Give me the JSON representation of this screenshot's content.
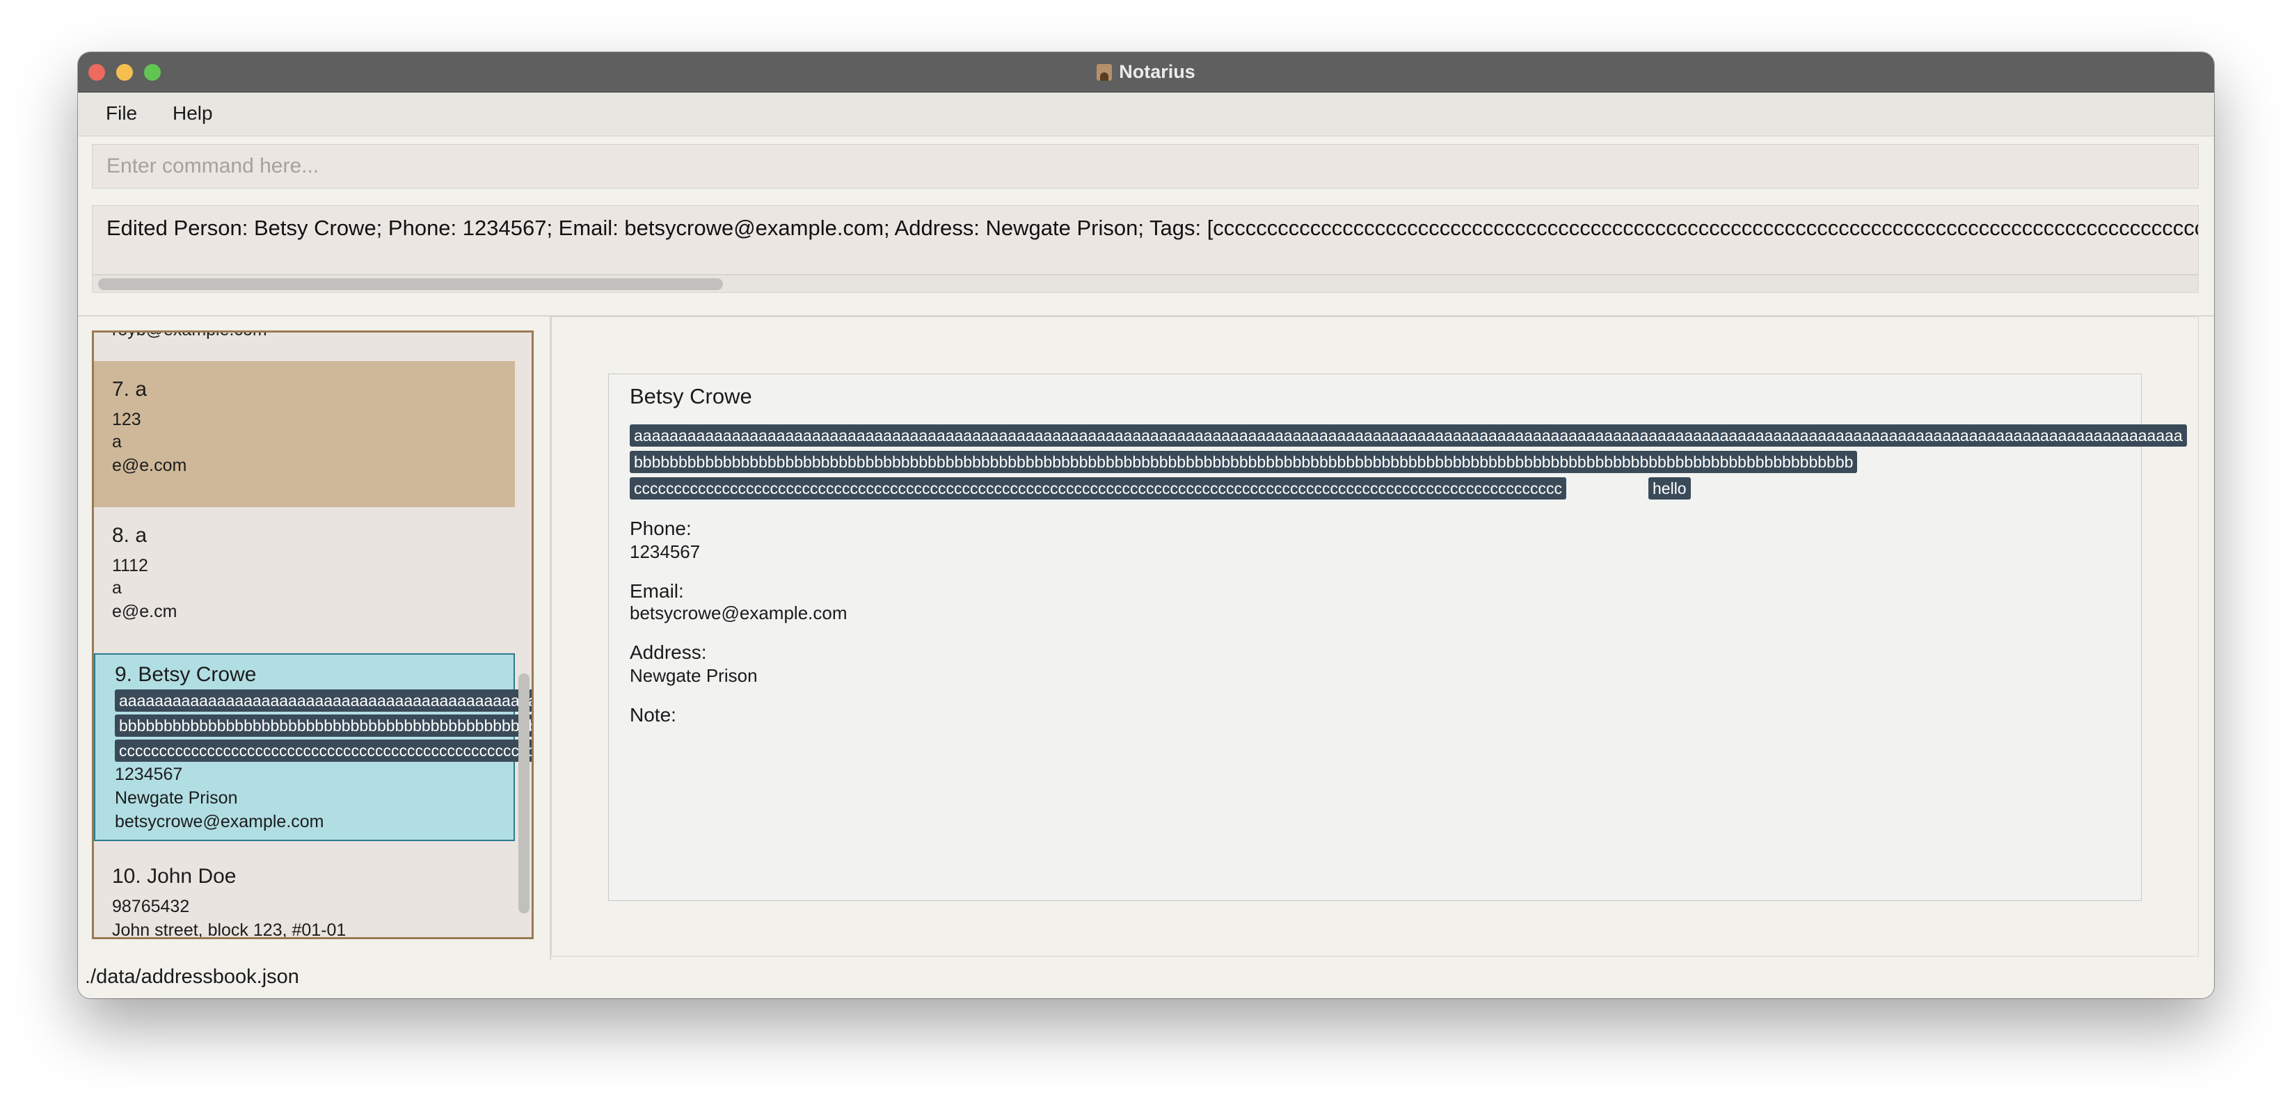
{
  "window": {
    "title": "Notarius"
  },
  "menu": {
    "file": "File",
    "help": "Help"
  },
  "command": {
    "placeholder": "Enter command here...",
    "value": ""
  },
  "result": {
    "text": "Edited Person: Betsy Crowe; Phone: 1234567; Email: betsycrowe@example.com; Address: Newgate Prison; Tags: [cccccccccccccccccccccccccccccccccccccccccccccccccccccccccccccccccccccccccccccccccccccccccccccccccccccccc"
  },
  "person_list": [
    {
      "index": "",
      "name": "",
      "lines": [
        "royb@example.com"
      ]
    },
    {
      "index": "7.",
      "name": "a",
      "lines": [
        "123",
        "a",
        "e@e.com"
      ]
    },
    {
      "index": "8.",
      "name": "a",
      "lines": [
        "1112",
        "a",
        "e@e.cm"
      ]
    },
    {
      "index": "9.",
      "name": "Betsy Crowe",
      "tags": [
        "aaaaaaaaaaaaaaaaaaaaaaaaaaaaaaaaaaaaaaaaaaaaaaaaaaaaa",
        "bbbbbbbbbbbbbbbbbbbbbbbbbbbbbbbbbbbbbbbbbbbbbbbbbbbbbbb",
        "cccccccccccccccccccccccccccccccccccccccccccccccccccccccccc"
      ],
      "lines": [
        "1234567",
        "Newgate Prison",
        "betsycrowe@example.com"
      ]
    },
    {
      "index": "10.",
      "name": "John Doe",
      "lines": [
        "98765432",
        "John street, block 123, #01-01"
      ]
    }
  ],
  "detail": {
    "name": "Betsy Crowe",
    "tags": [
      "aaaaaaaaaaaaaaaaaaaaaaaaaaaaaaaaaaaaaaaaaaaaaaaaaaaaaaaaaaaaaaaaaaaaaaaaaaaaaaaaaaaaaaaaaaaaaaaaaaaaaaaaaaaaaaaaaaaaaaaaaaaaaaaaaaaaaaaaaaaaaaaaaaaaaaaaaaaaaaaaaaaaaaaaaaaaaa",
      "bbbbbbbbbbbbbbbbbbbbbbbbbbbbbbbbbbbbbbbbbbbbbbbbbbbbbbbbbbbbbbbbbbbbbbbbbbbbbbbbbbbbbbbbbbbbbbbbbbbbbbbbbbbbbbbbbbbbbbbbbbbbbbbbbbbbbbbbb",
      "cccccccccccccccccccccccccccccccccccccccccccccccccccccccccccccccccccccccccccccccccccccccccccccccccccccccccccccccccccc",
      "hello"
    ],
    "phone_label": "Phone:",
    "phone": "1234567",
    "email_label": "Email:",
    "email": "betsycrowe@example.com",
    "address_label": "Address:",
    "address": "Newgate Prison",
    "note_label": "Note:",
    "note": ""
  },
  "status": {
    "file_path": "./data/addressbook.json"
  }
}
